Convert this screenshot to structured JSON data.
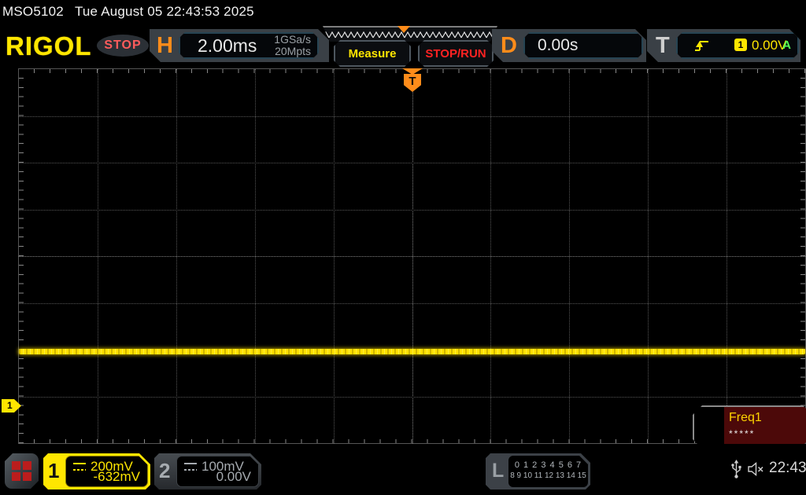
{
  "status_bar": {
    "model": "MSO5102",
    "datetime": "Tue August 05 22:43:53 2025"
  },
  "header": {
    "brand": "RIGOL",
    "run_state": "STOP",
    "horizontal": {
      "label": "H",
      "timebase": "2.00ms",
      "sample_rate": "1GSa/s",
      "memory_depth": "20Mpts"
    },
    "measure_label": "Measure",
    "stoprun_label": "STOP/RUN",
    "delay": {
      "label": "D",
      "value": "0.00s"
    },
    "trigger": {
      "label": "T",
      "source": "1",
      "level": "0.00V",
      "mode": "A",
      "edge_icon": "rising-edge-trigger-icon"
    }
  },
  "scope": {
    "trigger_marker_label": "T",
    "ch1_marker_label": "1",
    "freq_panel": {
      "title": "Freq1",
      "value": "*****"
    }
  },
  "bottom_bar": {
    "ch1": {
      "number": "1",
      "scale": "200mV",
      "offset": "-632mV",
      "coupling_icon": "dc-coupling-icon"
    },
    "ch2": {
      "number": "2",
      "scale": "100mV",
      "offset": "0.00V",
      "coupling_icon": "dc-coupling-icon"
    },
    "logic": {
      "label": "L",
      "row1": "0 1 2 3  4 5 6 7",
      "row2": "8 9 10 11 12 13 14 15"
    },
    "clock": "22:43"
  },
  "colors": {
    "accent_orange": "#ff8c1a",
    "channel1_yellow": "#ffe600",
    "channel2_gray": "#9aa0a5",
    "alert_red": "#ff2222",
    "auto_green": "#55ff55",
    "trace_yellow": "#ffe000"
  }
}
